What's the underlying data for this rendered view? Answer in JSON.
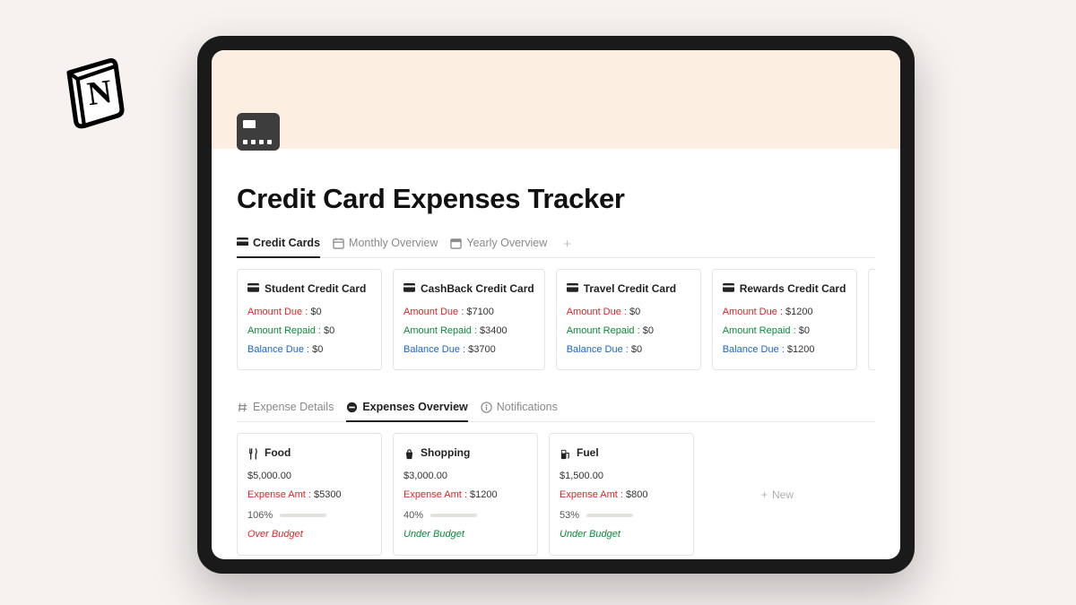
{
  "page": {
    "title": "Credit Card Expenses Tracker"
  },
  "tabs_top": {
    "items": [
      {
        "label": "Credit Cards",
        "icon": "credit-card-icon",
        "active": true
      },
      {
        "label": "Monthly Overview",
        "icon": "calendar-grid-icon",
        "active": false
      },
      {
        "label": "Yearly Overview",
        "icon": "calendar-icon",
        "active": false
      }
    ],
    "add_label": "+"
  },
  "credit_cards": [
    {
      "name": "Student Credit Card",
      "amount_due_label": "Amount Due :",
      "amount_due": "$0",
      "amount_repaid_label": "Amount Repaid :",
      "amount_repaid": "$0",
      "balance_due_label": "Balance Due :",
      "balance_due": "$0"
    },
    {
      "name": "CashBack Credit Card",
      "amount_due_label": "Amount Due :",
      "amount_due": "$7100",
      "amount_repaid_label": "Amount Repaid :",
      "amount_repaid": "$3400",
      "balance_due_label": "Balance Due :",
      "balance_due": "$3700"
    },
    {
      "name": "Travel Credit Card",
      "amount_due_label": "Amount Due :",
      "amount_due": "$0",
      "amount_repaid_label": "Amount Repaid :",
      "amount_repaid": "$0",
      "balance_due_label": "Balance Due :",
      "balance_due": "$0"
    },
    {
      "name": "Rewards Credit Card",
      "amount_due_label": "Amount Due :",
      "amount_due": "$1200",
      "amount_repaid_label": "Amount Repaid :",
      "amount_repaid": "$0",
      "balance_due_label": "Balance Due :",
      "balance_due": "$1200"
    }
  ],
  "tabs_bottom": {
    "items": [
      {
        "label": "Expense Details",
        "icon": "hash-icon",
        "active": false
      },
      {
        "label": "Expenses Overview",
        "icon": "minus-circle-icon",
        "active": true
      },
      {
        "label": "Notifications",
        "icon": "info-icon",
        "active": false
      }
    ]
  },
  "expenses": [
    {
      "name": "Food",
      "icon": "food-icon",
      "budget": "$5,000.00",
      "expense_label": "Expense Amt :",
      "expense": "$5300",
      "pct_label": "106%",
      "pct": 100,
      "status": "Over Budget",
      "status_kind": "over"
    },
    {
      "name": "Shopping",
      "icon": "shopping-icon",
      "budget": "$3,000.00",
      "expense_label": "Expense Amt :",
      "expense": "$1200",
      "pct_label": "40%",
      "pct": 40,
      "status": "Under Budget",
      "status_kind": "under"
    },
    {
      "name": "Fuel",
      "icon": "fuel-icon",
      "budget": "$1,500.00",
      "expense_label": "Expense Amt :",
      "expense": "$800",
      "pct_label": "53%",
      "pct": 53,
      "status": "Under Budget",
      "status_kind": "under"
    }
  ],
  "new_card_label": "New"
}
